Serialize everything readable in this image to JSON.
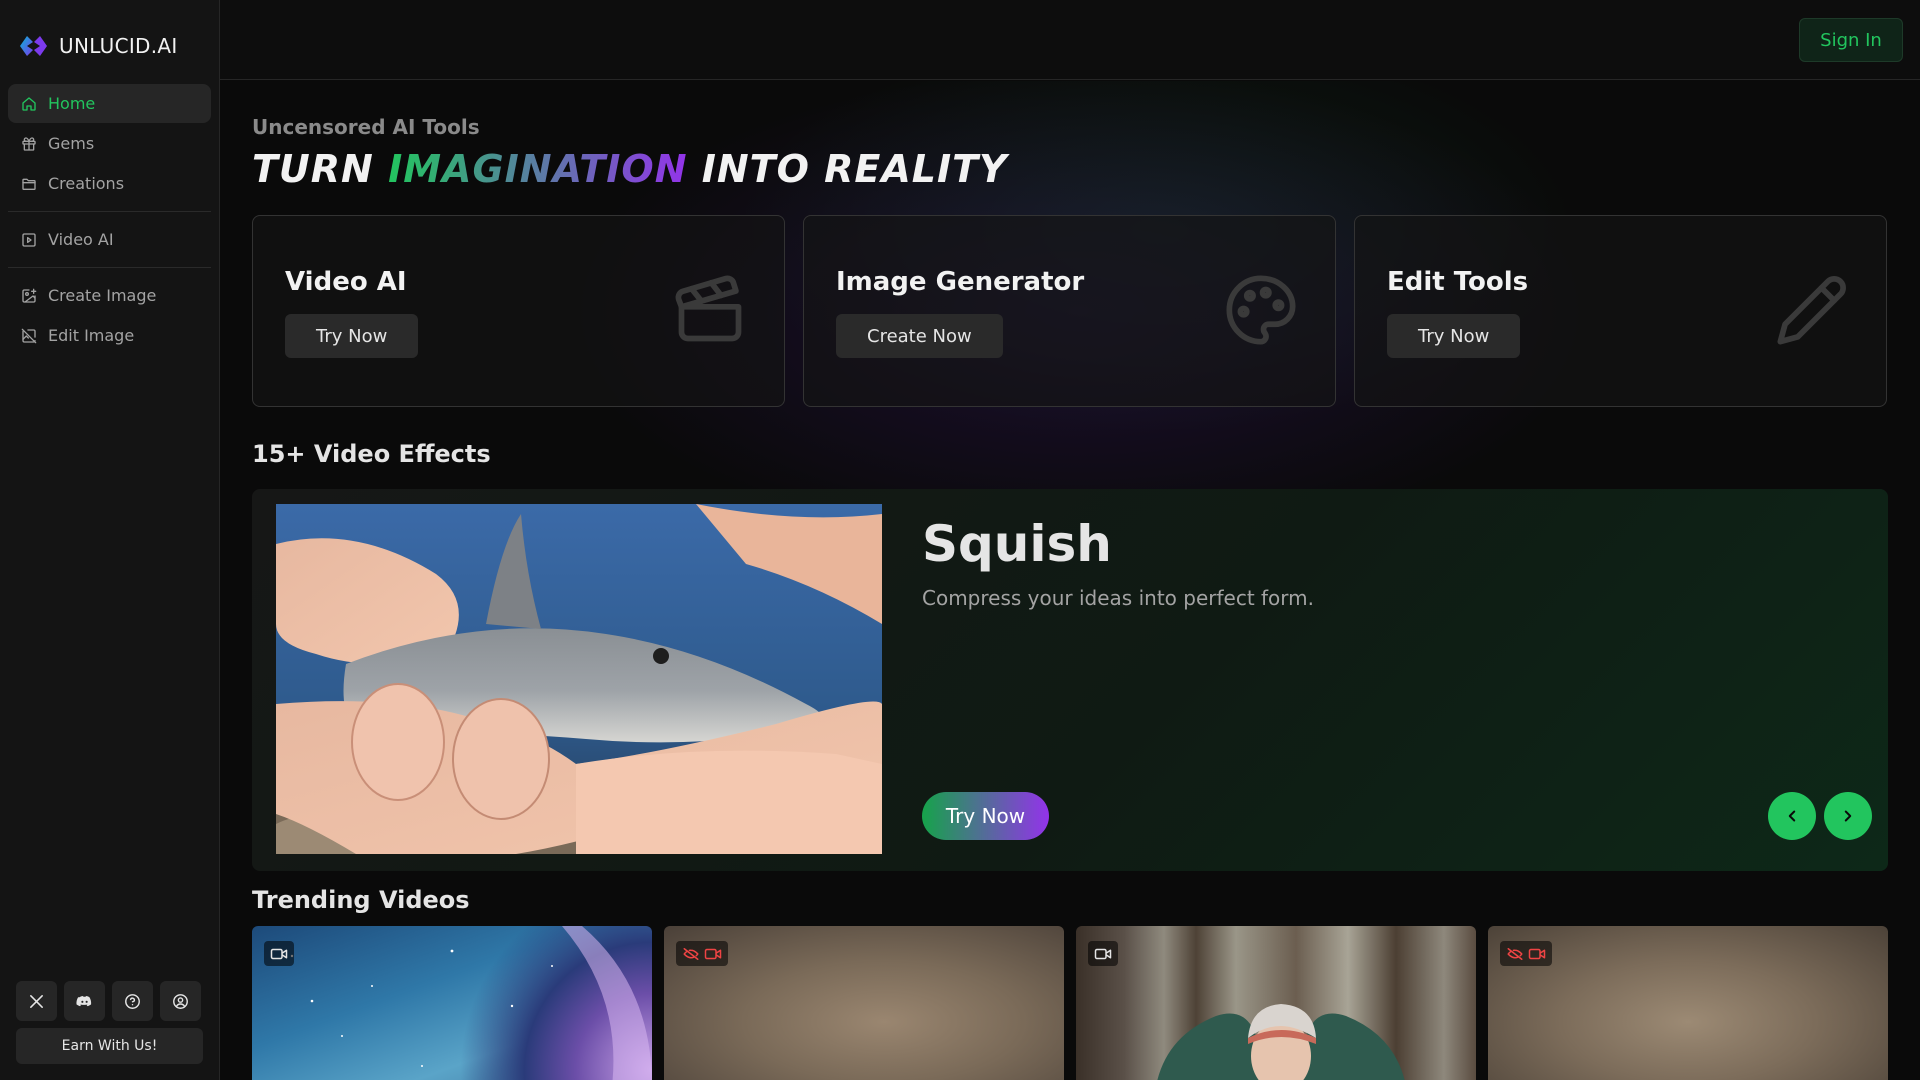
{
  "app": {
    "brand": "UNLUCID.AI"
  },
  "sidebar": {
    "items": [
      {
        "label": "Home",
        "icon": "home-icon",
        "active": true
      },
      {
        "label": "Gems",
        "icon": "gift-icon"
      },
      {
        "label": "Creations",
        "icon": "folder-icon"
      },
      {
        "label": "Video AI",
        "icon": "play-square-icon"
      },
      {
        "label": "Create Image",
        "icon": "image-plus-icon"
      },
      {
        "label": "Edit Image",
        "icon": "image-off-icon"
      }
    ],
    "social": [
      "x-icon",
      "discord-icon",
      "help-circle-icon",
      "user-circle-icon"
    ],
    "earn_label": "Earn With Us!"
  },
  "header": {
    "signin_label": "Sign In"
  },
  "hero": {
    "eyebrow": "Uncensored AI Tools",
    "headline_pre": "TURN ",
    "headline_highlight": "IMAGINATION",
    "headline_post": " INTO REALITY"
  },
  "cards": [
    {
      "title": "Video AI",
      "button": "Try Now",
      "icon": "clapperboard-icon"
    },
    {
      "title": "Image Generator",
      "button": "Create Now",
      "icon": "palette-icon"
    },
    {
      "title": "Edit Tools",
      "button": "Try Now",
      "icon": "pencil-icon"
    }
  ],
  "effects": {
    "section_title": "15+ Video Effects",
    "slide": {
      "title": "Squish",
      "description": "Compress your ideas into perfect form.",
      "cta": "Try Now"
    }
  },
  "trending": {
    "section_title": "Trending Videos",
    "videos": [
      {
        "badge": "video-icon",
        "kind": "space"
      },
      {
        "badge": "eye-off-video-icon",
        "kind": "blurred"
      },
      {
        "badge": "video-icon",
        "kind": "forest"
      },
      {
        "badge": "eye-off-video-icon",
        "kind": "blurred"
      }
    ]
  },
  "colors": {
    "accent_green": "#22c55e",
    "accent_purple": "#9333ea",
    "background": "#0a0a0a",
    "sidebar": "#141414"
  }
}
